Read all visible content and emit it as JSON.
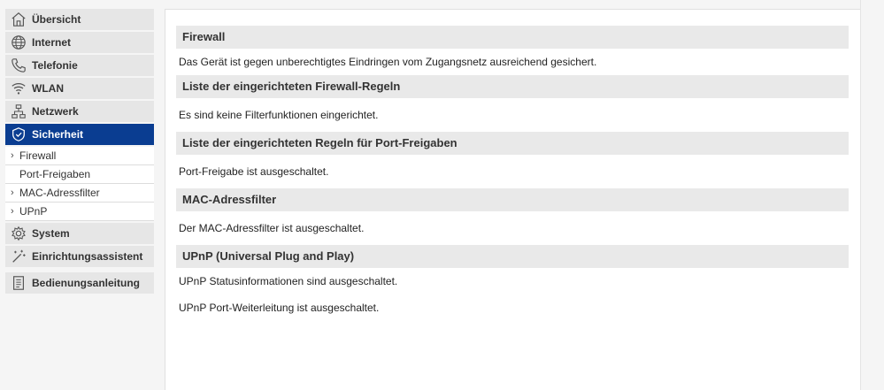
{
  "sidebar": {
    "items": [
      {
        "label": "Übersicht",
        "icon": "home-icon"
      },
      {
        "label": "Internet",
        "icon": "globe-icon"
      },
      {
        "label": "Telefonie",
        "icon": "phone-icon"
      },
      {
        "label": "WLAN",
        "icon": "wifi-icon"
      },
      {
        "label": "Netzwerk",
        "icon": "network-icon"
      },
      {
        "label": "Sicherheit",
        "icon": "shield-icon",
        "active": true
      }
    ],
    "subitems": [
      {
        "label": "Firewall",
        "chevron": true
      },
      {
        "label": "Port-Freigaben",
        "chevron": false
      },
      {
        "label": "MAC-Adressfilter",
        "chevron": true
      },
      {
        "label": "UPnP",
        "chevron": true
      }
    ],
    "items_after": [
      {
        "label": "System",
        "icon": "gear-icon"
      },
      {
        "label": "Einrichtungsassistent",
        "icon": "wand-icon"
      },
      {
        "label": "Bedienungsanleitung",
        "icon": "document-icon"
      }
    ]
  },
  "main": {
    "sections": [
      {
        "title": "Firewall",
        "lines": [
          "Das Gerät ist gegen unberechtigtes Eindringen vom Zugangsnetz ausreichend gesichert."
        ]
      },
      {
        "title": "Liste der eingerichteten Firewall-Regeln",
        "lines": [
          "Es sind keine Filterfunktionen eingerichtet."
        ]
      },
      {
        "title": "Liste der eingerichteten Regeln für Port-Freigaben",
        "lines": [
          "Port-Freigabe ist ausgeschaltet."
        ]
      },
      {
        "title": "MAC-Adressfilter",
        "lines": [
          "Der MAC-Adressfilter ist ausgeschaltet."
        ]
      },
      {
        "title": "UPnP (Universal Plug and Play)",
        "lines": [
          "UPnP Statusinformationen sind ausgeschaltet.",
          "UPnP Port-Weiterleitung ist ausgeschaltet."
        ]
      }
    ]
  },
  "colors": {
    "active": "#0a3d91",
    "nav_bg": "#e6e6e6",
    "section_bg": "#e9e9e9"
  }
}
